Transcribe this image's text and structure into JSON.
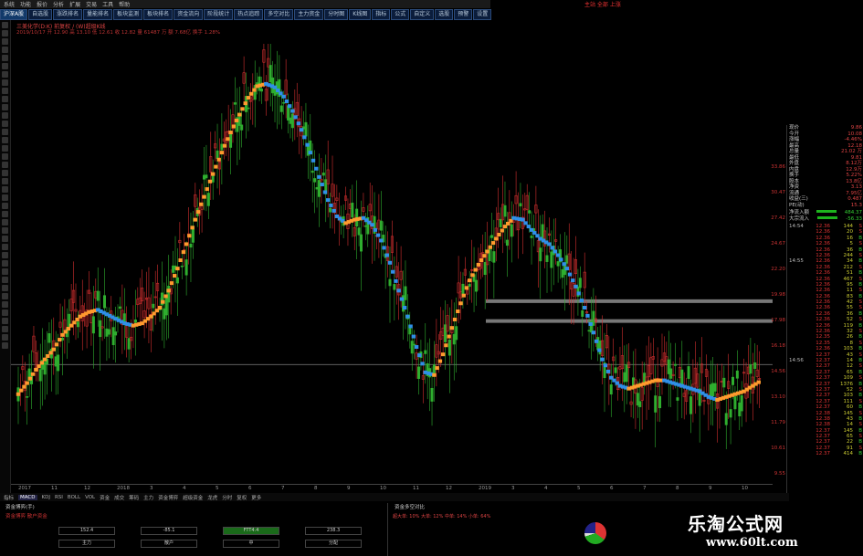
{
  "menu": [
    "系统",
    "功能",
    "报价",
    "分析",
    "扩展",
    "交易",
    "工具",
    "帮助"
  ],
  "title_right": "主站  全部  上涨",
  "toolbar": [
    "沪深A股",
    "自选股",
    "涨跌排名",
    "量能排名",
    "板块监测",
    "板块排名",
    "资金流向",
    "阶段统计",
    "热点追踪",
    "多空对比",
    "主力资金",
    "分时图",
    "K线图",
    "指标",
    "公式",
    "自定义",
    "选股",
    "预警",
    "设置"
  ],
  "info_line1": "三美化学(D:K) 前复权 / (W)超级K线",
  "info_line2": "2019/10/17  开 12.90  高 13.10  低 12.61  收 12.82  量 61487 万  额 7.68亿  换手 1.28%",
  "axis_labels": [
    "33.86",
    "30.47",
    "27.42",
    "24.67",
    "22.20",
    "19.98",
    "17.98",
    "16.18",
    "14.56",
    "13.10",
    "11.79",
    "10.61",
    "9.55"
  ],
  "quote": [
    {
      "k": "现价",
      "v": "9.86"
    },
    {
      "k": "今开",
      "v": "10.08"
    },
    {
      "k": "涨幅",
      "v": "-4.46%"
    },
    {
      "k": "最高",
      "v": "12.18"
    },
    {
      "k": "总量",
      "v": "21.02 万"
    },
    {
      "k": "最低",
      "v": "9.81"
    },
    {
      "k": "外盘",
      "v": "8.12万"
    },
    {
      "k": "内盘",
      "v": "12.9万"
    },
    {
      "k": "换手",
      "v": "5.22%"
    },
    {
      "k": "股本",
      "v": "13.8亿"
    },
    {
      "k": "净资",
      "v": "3.13"
    },
    {
      "k": "流通",
      "v": "7.95亿"
    },
    {
      "k": "收益(三)",
      "v": "0.487"
    },
    {
      "k": "PE(动)",
      "v": "15.3"
    }
  ],
  "flow": [
    {
      "k": "净流入额",
      "v": "484.37"
    },
    {
      "k": "大宗流入",
      "v": "-56.33"
    }
  ],
  "ticks": [
    {
      "t": "14:54",
      "p": "12.36",
      "v": "144",
      "b": "S"
    },
    {
      "t": "",
      "p": "12.36",
      "v": "20",
      "b": "S"
    },
    {
      "t": "",
      "p": "12.36",
      "v": "16",
      "b": "B"
    },
    {
      "t": "",
      "p": "12.36",
      "v": "5",
      "b": "S"
    },
    {
      "t": "",
      "p": "12.36",
      "v": "36",
      "b": "B"
    },
    {
      "t": "",
      "p": "12.36",
      "v": "244",
      "b": "S"
    },
    {
      "t": "14:55",
      "p": "12.36",
      "v": "34",
      "b": "B"
    },
    {
      "t": "",
      "p": "12.36",
      "v": "212",
      "b": "S"
    },
    {
      "t": "",
      "p": "12.36",
      "v": "51",
      "b": "B"
    },
    {
      "t": "",
      "p": "12.36",
      "v": "467",
      "b": "S"
    },
    {
      "t": "",
      "p": "12.36",
      "v": "95",
      "b": "B"
    },
    {
      "t": "",
      "p": "12.36",
      "v": "11",
      "b": "S"
    },
    {
      "t": "",
      "p": "12.36",
      "v": "83",
      "b": "B"
    },
    {
      "t": "",
      "p": "12.36",
      "v": "42",
      "b": "S"
    },
    {
      "t": "",
      "p": "12.36",
      "v": "55",
      "b": "S"
    },
    {
      "t": "",
      "p": "12.36",
      "v": "36",
      "b": "B"
    },
    {
      "t": "",
      "p": "12.36",
      "v": "52",
      "b": "S"
    },
    {
      "t": "",
      "p": "12.36",
      "v": "119",
      "b": "B"
    },
    {
      "t": "",
      "p": "12.36",
      "v": "32",
      "b": "S"
    },
    {
      "t": "",
      "p": "12.35",
      "v": "26",
      "b": "B"
    },
    {
      "t": "",
      "p": "12.35",
      "v": "8",
      "b": "S"
    },
    {
      "t": "",
      "p": "12.36",
      "v": "103",
      "b": "B"
    },
    {
      "t": "",
      "p": "12.37",
      "v": "43",
      "b": "S"
    },
    {
      "t": "14:56",
      "p": "12.37",
      "v": "14",
      "b": "B"
    },
    {
      "t": "",
      "p": "12.37",
      "v": "12",
      "b": "S"
    },
    {
      "t": "",
      "p": "12.37",
      "v": "65",
      "b": "B"
    },
    {
      "t": "",
      "p": "12.37",
      "v": "109",
      "b": "S"
    },
    {
      "t": "",
      "p": "12.37",
      "v": "1376",
      "b": "B"
    },
    {
      "t": "",
      "p": "12.37",
      "v": "52",
      "b": "S"
    },
    {
      "t": "",
      "p": "12.37",
      "v": "103",
      "b": "B"
    },
    {
      "t": "",
      "p": "12.37",
      "v": "111",
      "b": "S"
    },
    {
      "t": "",
      "p": "12.37",
      "v": "60",
      "b": "B"
    },
    {
      "t": "",
      "p": "12.38",
      "v": "145",
      "b": "S"
    },
    {
      "t": "",
      "p": "12.38",
      "v": "43",
      "b": "B"
    },
    {
      "t": "",
      "p": "12.38",
      "v": "14",
      "b": "S"
    },
    {
      "t": "",
      "p": "12.37",
      "v": "145",
      "b": "B"
    },
    {
      "t": "",
      "p": "12.37",
      "v": "65",
      "b": "S"
    },
    {
      "t": "",
      "p": "12.37",
      "v": "22",
      "b": "B"
    },
    {
      "t": "",
      "p": "12.37",
      "v": "91",
      "b": "S"
    },
    {
      "t": "",
      "p": "12.37",
      "v": "414",
      "b": "B"
    }
  ],
  "time_labels": [
    "2017",
    "11",
    "12",
    "2018",
    "3",
    "4",
    "5",
    "6",
    "7",
    "8",
    "9",
    "10",
    "11",
    "12",
    "2019",
    "3",
    "4",
    "5",
    "6",
    "7",
    "8",
    "9",
    "10"
  ],
  "bottom_tabs": [
    "指标",
    "MACD",
    "KDJ",
    "RSI",
    "BOLL",
    "VOL",
    "资金",
    "成交",
    "筹码",
    "主力",
    "资金博弈",
    "超级资金",
    "龙虎",
    "分时",
    "复权",
    "更多"
  ],
  "panel_left": {
    "title": "资金博弈(手)",
    "legend": "资金博弈  散户资金",
    "gauges": [
      "152.4",
      "主力",
      "-85.1",
      "散户",
      "FTT4.4",
      "中",
      "238.3",
      "分配"
    ]
  },
  "panel_mid": {
    "title": "资金多空对比",
    "row": "超大单: 10%  大单: 12%  中单: 14%  小单: 64%"
  },
  "watermark_cn": "乐淘公式网",
  "watermark_url": "www.60lt.com",
  "colors": {
    "up": "#d32f2f",
    "down": "#2fae2f",
    "ribbon_orange": "#ff9a2e",
    "ribbon_blue": "#2f8fe8"
  },
  "chart_data": {
    "type": "line",
    "title": "",
    "xlabel": "",
    "ylabel": "",
    "ylim": [
      9.55,
      33.86
    ],
    "series": [
      {
        "values": [
          12.1,
          12.5,
          13.0,
          13.4,
          13.8,
          14.4,
          14.8,
          15.2,
          15.4,
          15.5,
          15.3,
          15.1,
          14.9,
          14.8,
          14.9,
          15.2,
          15.6,
          16.4,
          17.5,
          18.8,
          20.2,
          21.6,
          23.1,
          24.6,
          26.1,
          27.5,
          28.9,
          29.9,
          30.1,
          29.8,
          29.0,
          27.8,
          26.3,
          24.6,
          22.9,
          21.4,
          20.4,
          20.0,
          20.2,
          20.3,
          19.9,
          19.0,
          17.8,
          16.4,
          15.2,
          13.9,
          12.9,
          12.8,
          13.6,
          14.7,
          15.8,
          16.9,
          17.7,
          18.4,
          19.1,
          19.8,
          20.3,
          20.2,
          19.6,
          19.1,
          18.8,
          18.2,
          17.5,
          16.6,
          15.6,
          14.5,
          13.4,
          12.7,
          12.4,
          12.3,
          12.4,
          12.5,
          12.6,
          12.6,
          12.5,
          12.4,
          12.3,
          12.2,
          12.0,
          11.9,
          12.0,
          12.1,
          12.2,
          12.4,
          12.6
        ]
      }
    ]
  }
}
